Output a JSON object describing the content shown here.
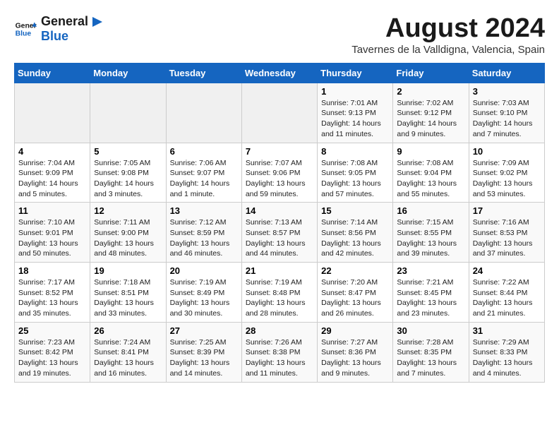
{
  "logo": {
    "line1": "General",
    "line2": "Blue"
  },
  "title": "August 2024",
  "subtitle": "Tavernes de la Valldigna, Valencia, Spain",
  "days_of_week": [
    "Sunday",
    "Monday",
    "Tuesday",
    "Wednesday",
    "Thursday",
    "Friday",
    "Saturday"
  ],
  "weeks": [
    [
      {
        "day": "",
        "info": ""
      },
      {
        "day": "",
        "info": ""
      },
      {
        "day": "",
        "info": ""
      },
      {
        "day": "",
        "info": ""
      },
      {
        "day": "1",
        "info": "Sunrise: 7:01 AM\nSunset: 9:13 PM\nDaylight: 14 hours and 11 minutes."
      },
      {
        "day": "2",
        "info": "Sunrise: 7:02 AM\nSunset: 9:12 PM\nDaylight: 14 hours and 9 minutes."
      },
      {
        "day": "3",
        "info": "Sunrise: 7:03 AM\nSunset: 9:10 PM\nDaylight: 14 hours and 7 minutes."
      }
    ],
    [
      {
        "day": "4",
        "info": "Sunrise: 7:04 AM\nSunset: 9:09 PM\nDaylight: 14 hours and 5 minutes."
      },
      {
        "day": "5",
        "info": "Sunrise: 7:05 AM\nSunset: 9:08 PM\nDaylight: 14 hours and 3 minutes."
      },
      {
        "day": "6",
        "info": "Sunrise: 7:06 AM\nSunset: 9:07 PM\nDaylight: 14 hours and 1 minute."
      },
      {
        "day": "7",
        "info": "Sunrise: 7:07 AM\nSunset: 9:06 PM\nDaylight: 13 hours and 59 minutes."
      },
      {
        "day": "8",
        "info": "Sunrise: 7:08 AM\nSunset: 9:05 PM\nDaylight: 13 hours and 57 minutes."
      },
      {
        "day": "9",
        "info": "Sunrise: 7:08 AM\nSunset: 9:04 PM\nDaylight: 13 hours and 55 minutes."
      },
      {
        "day": "10",
        "info": "Sunrise: 7:09 AM\nSunset: 9:02 PM\nDaylight: 13 hours and 53 minutes."
      }
    ],
    [
      {
        "day": "11",
        "info": "Sunrise: 7:10 AM\nSunset: 9:01 PM\nDaylight: 13 hours and 50 minutes."
      },
      {
        "day": "12",
        "info": "Sunrise: 7:11 AM\nSunset: 9:00 PM\nDaylight: 13 hours and 48 minutes."
      },
      {
        "day": "13",
        "info": "Sunrise: 7:12 AM\nSunset: 8:59 PM\nDaylight: 13 hours and 46 minutes."
      },
      {
        "day": "14",
        "info": "Sunrise: 7:13 AM\nSunset: 8:57 PM\nDaylight: 13 hours and 44 minutes."
      },
      {
        "day": "15",
        "info": "Sunrise: 7:14 AM\nSunset: 8:56 PM\nDaylight: 13 hours and 42 minutes."
      },
      {
        "day": "16",
        "info": "Sunrise: 7:15 AM\nSunset: 8:55 PM\nDaylight: 13 hours and 39 minutes."
      },
      {
        "day": "17",
        "info": "Sunrise: 7:16 AM\nSunset: 8:53 PM\nDaylight: 13 hours and 37 minutes."
      }
    ],
    [
      {
        "day": "18",
        "info": "Sunrise: 7:17 AM\nSunset: 8:52 PM\nDaylight: 13 hours and 35 minutes."
      },
      {
        "day": "19",
        "info": "Sunrise: 7:18 AM\nSunset: 8:51 PM\nDaylight: 13 hours and 33 minutes."
      },
      {
        "day": "20",
        "info": "Sunrise: 7:19 AM\nSunset: 8:49 PM\nDaylight: 13 hours and 30 minutes."
      },
      {
        "day": "21",
        "info": "Sunrise: 7:19 AM\nSunset: 8:48 PM\nDaylight: 13 hours and 28 minutes."
      },
      {
        "day": "22",
        "info": "Sunrise: 7:20 AM\nSunset: 8:47 PM\nDaylight: 13 hours and 26 minutes."
      },
      {
        "day": "23",
        "info": "Sunrise: 7:21 AM\nSunset: 8:45 PM\nDaylight: 13 hours and 23 minutes."
      },
      {
        "day": "24",
        "info": "Sunrise: 7:22 AM\nSunset: 8:44 PM\nDaylight: 13 hours and 21 minutes."
      }
    ],
    [
      {
        "day": "25",
        "info": "Sunrise: 7:23 AM\nSunset: 8:42 PM\nDaylight: 13 hours and 19 minutes."
      },
      {
        "day": "26",
        "info": "Sunrise: 7:24 AM\nSunset: 8:41 PM\nDaylight: 13 hours and 16 minutes."
      },
      {
        "day": "27",
        "info": "Sunrise: 7:25 AM\nSunset: 8:39 PM\nDaylight: 13 hours and 14 minutes."
      },
      {
        "day": "28",
        "info": "Sunrise: 7:26 AM\nSunset: 8:38 PM\nDaylight: 13 hours and 11 minutes."
      },
      {
        "day": "29",
        "info": "Sunrise: 7:27 AM\nSunset: 8:36 PM\nDaylight: 13 hours and 9 minutes."
      },
      {
        "day": "30",
        "info": "Sunrise: 7:28 AM\nSunset: 8:35 PM\nDaylight: 13 hours and 7 minutes."
      },
      {
        "day": "31",
        "info": "Sunrise: 7:29 AM\nSunset: 8:33 PM\nDaylight: 13 hours and 4 minutes."
      }
    ]
  ]
}
